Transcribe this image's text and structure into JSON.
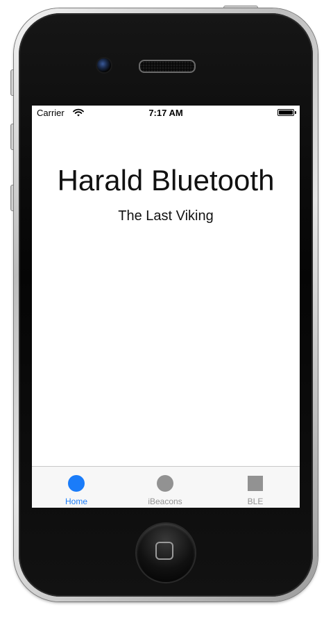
{
  "status_bar": {
    "carrier": "Carrier",
    "time": "7:17 AM"
  },
  "main": {
    "title": "Harald Bluetooth",
    "subtitle": "The Last Viking"
  },
  "tab_bar": {
    "tabs": [
      {
        "label": "Home",
        "icon": "circle-icon",
        "active": true
      },
      {
        "label": "iBeacons",
        "icon": "circle-icon",
        "active": false
      },
      {
        "label": "BLE",
        "icon": "square-icon",
        "active": false
      }
    ]
  },
  "colors": {
    "tint": "#1a7cf9",
    "inactive": "#929292",
    "tab_bar_bg": "#f7f7f7"
  }
}
